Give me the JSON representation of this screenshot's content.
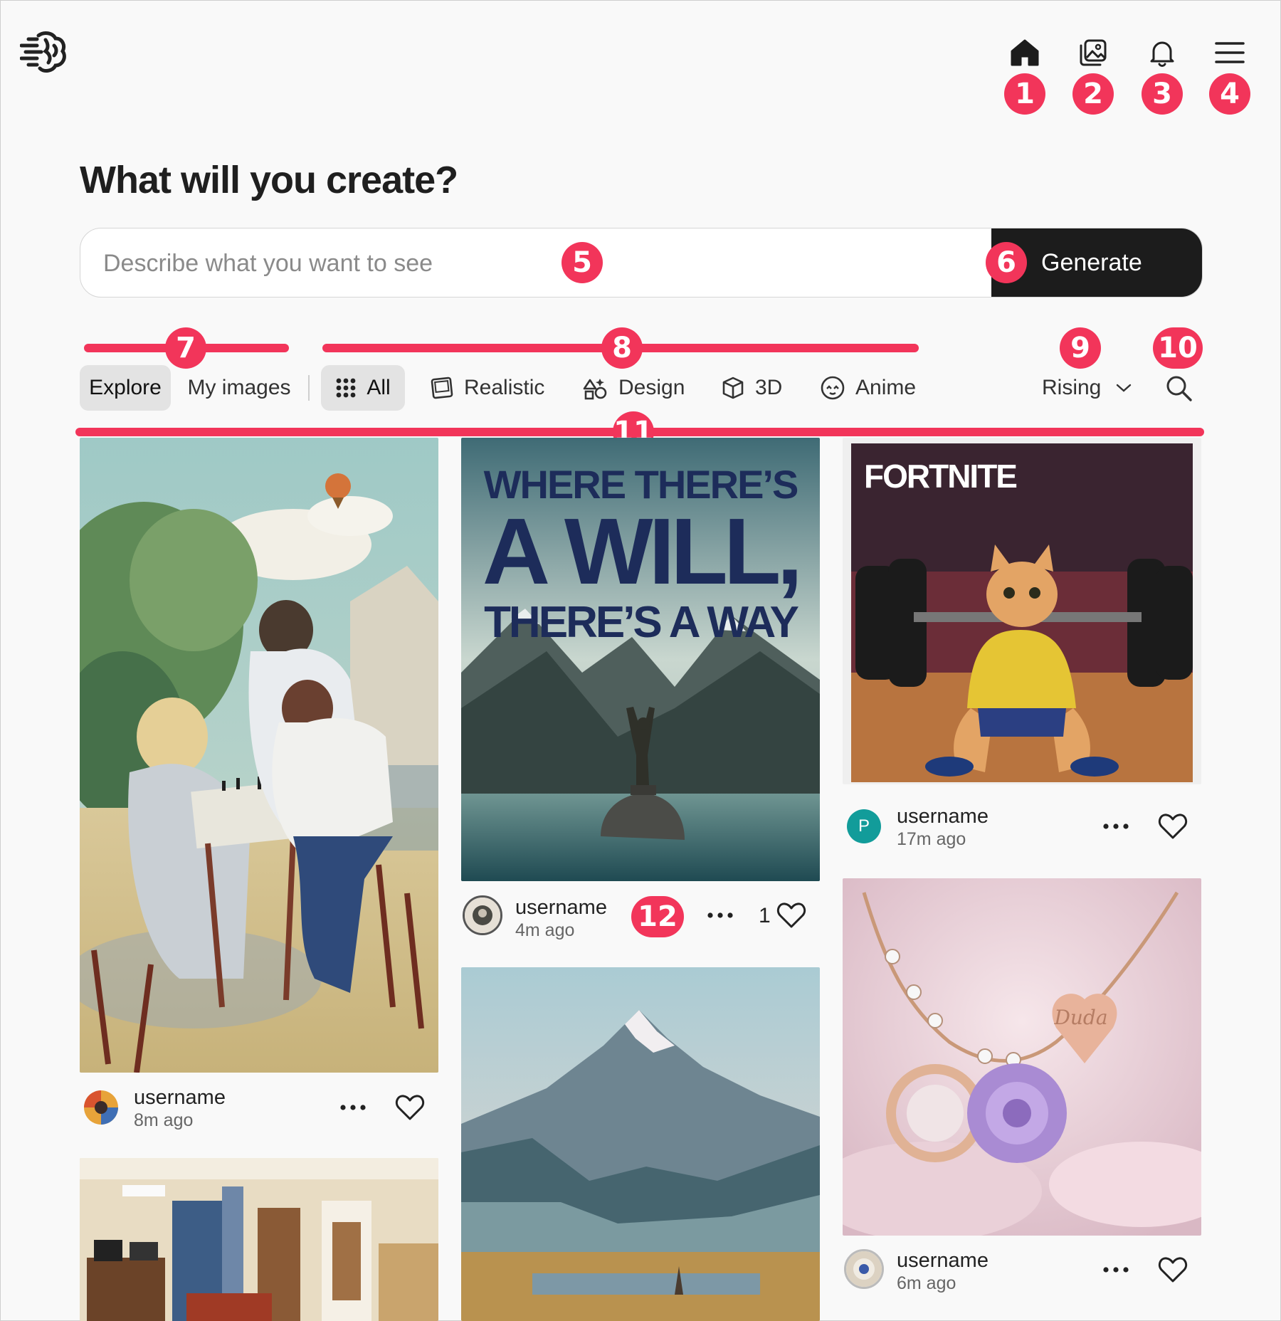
{
  "header": {
    "title": "What will you create?",
    "nav": [
      {
        "name": "home-icon",
        "label": "Home"
      },
      {
        "name": "gallery-icon",
        "label": "Gallery"
      },
      {
        "name": "bell-icon",
        "label": "Notifications"
      },
      {
        "name": "menu-icon",
        "label": "Menu"
      }
    ]
  },
  "prompt": {
    "placeholder": "Describe what you want to see",
    "value": "",
    "generate_label": "Generate"
  },
  "tabs": {
    "explore": "Explore",
    "my_images": "My images"
  },
  "categories": [
    "All",
    "Realistic",
    "Design",
    "3D",
    "Anime"
  ],
  "active_category": "All",
  "sort": {
    "selected": "Rising"
  },
  "markers": [
    "1",
    "2",
    "3",
    "4",
    "5",
    "6",
    "7",
    "8",
    "9",
    "10",
    "11",
    "12"
  ],
  "cards": {
    "c1": {
      "username": "username",
      "time": "8m ago"
    },
    "c2": {
      "username": "username",
      "time": "4m ago",
      "likes": "1"
    },
    "c3": {
      "username": "username",
      "time": "17m ago",
      "avatar_letter": "P"
    },
    "c4": {
      "username": "username",
      "time": "6m ago"
    }
  },
  "poster_text": {
    "line1": "WHERE THERE’S",
    "line2": "A WILL,",
    "line3": "THERE’S A WAY"
  },
  "fortnite_logo": "FORTNITE",
  "pendant_text": "Duda",
  "colors": {
    "accent": "#f2355a",
    "dark": "#1c1c1c",
    "teal": "#129c9a"
  }
}
